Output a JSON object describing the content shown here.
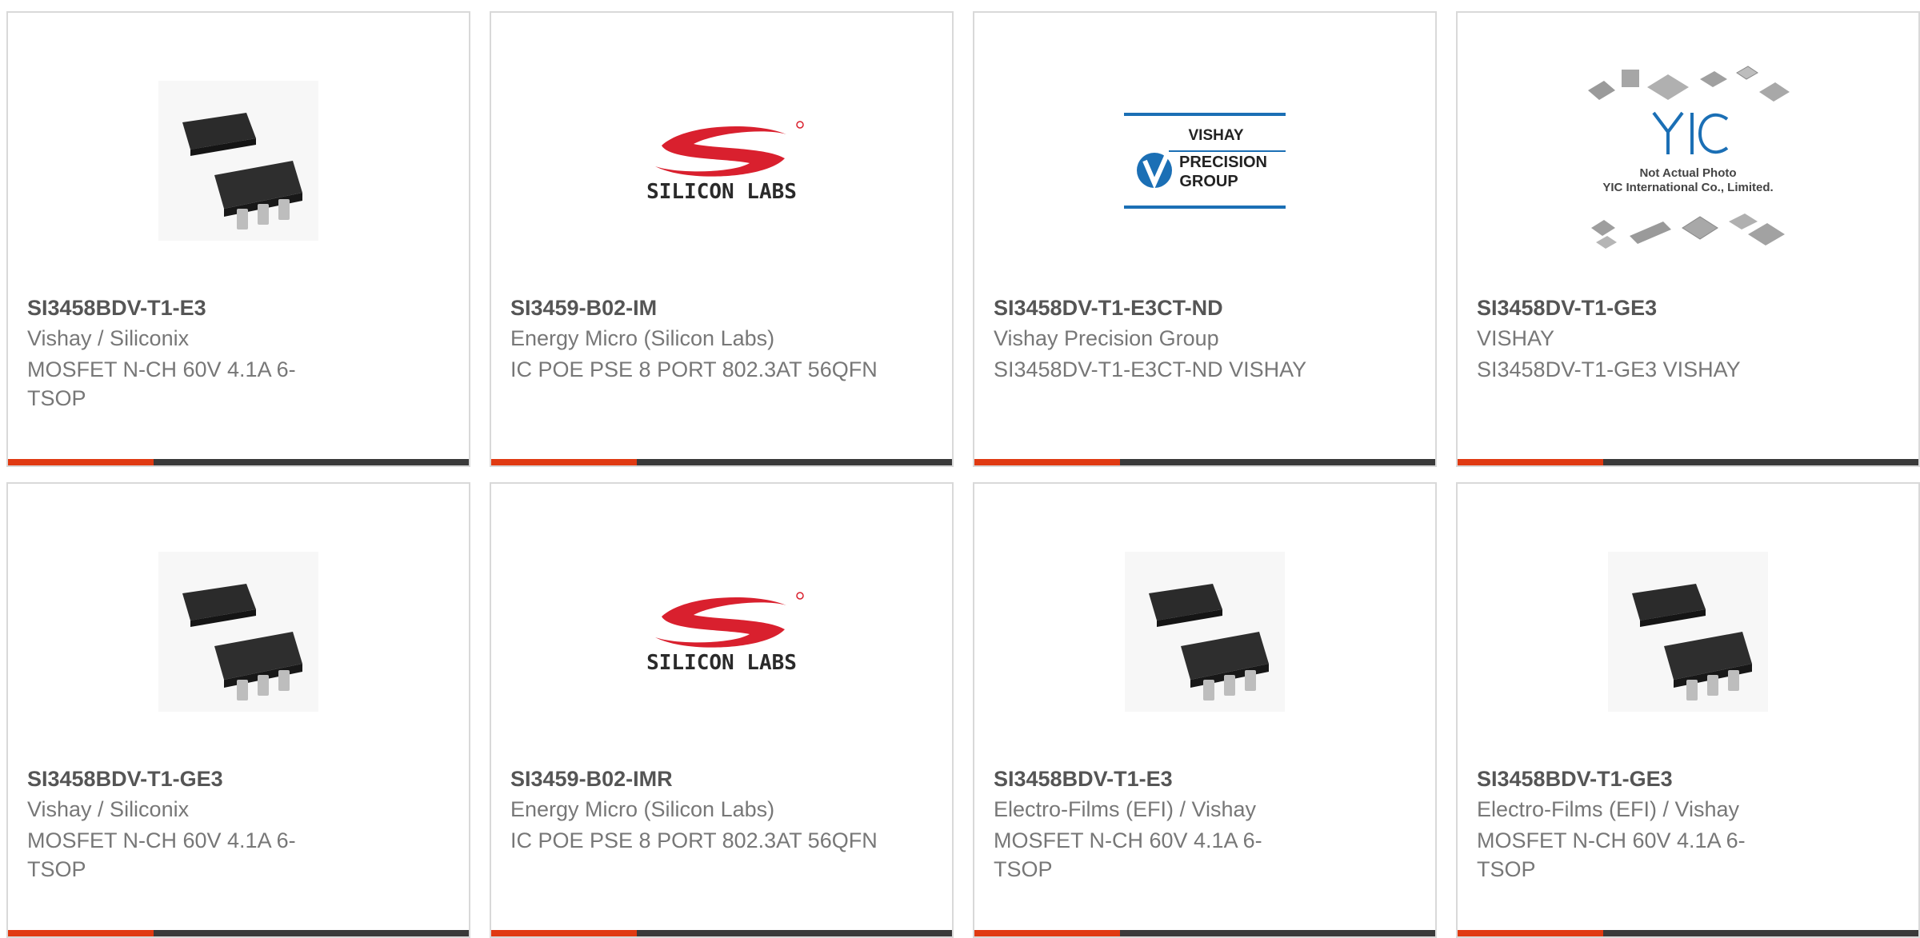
{
  "products": [
    {
      "part": "SI3458BDV-T1-E3",
      "maker": "Vishay / Siliconix",
      "desc": "MOSFET N-CH 60V 4.1A 6-TSOP",
      "image_icon": "chip-package-icon"
    },
    {
      "part": "SI3459-B02-IM",
      "maker": "Energy Micro (Silicon Labs)",
      "desc": "IC POE PSE 8 PORT 802.3AT 56QFN",
      "image_icon": "silicon-labs-logo",
      "logo_text": "SILICON LABS"
    },
    {
      "part": "SI3458DV-T1-E3CT-ND",
      "maker": "Vishay Precision Group",
      "desc": "SI3458DV-T1-E3CT-ND VISHAY",
      "image_icon": "vishay-precision-group-logo",
      "logo_lines": [
        "VISHAY",
        "PRECISION",
        "GROUP"
      ]
    },
    {
      "part": "SI3458DV-T1-GE3",
      "maker": "VISHAY",
      "desc": "SI3458DV-T1-GE3 VISHAY",
      "image_icon": "yic-placeholder-photo",
      "placeholder_lines": [
        "Not Actual Photo",
        "YIC International Co., Limited."
      ]
    },
    {
      "part": "SI3458BDV-T1-GE3",
      "maker": "Vishay / Siliconix",
      "desc": "MOSFET N-CH 60V 4.1A 6-TSOP",
      "image_icon": "chip-package-icon"
    },
    {
      "part": "SI3459-B02-IMR",
      "maker": "Energy Micro (Silicon Labs)",
      "desc": "IC POE PSE 8 PORT 802.3AT 56QFN",
      "image_icon": "silicon-labs-logo",
      "logo_text": "SILICON LABS"
    },
    {
      "part": "SI3458BDV-T1-E3",
      "maker": "Electro-Films (EFI) / Vishay",
      "desc": "MOSFET N-CH 60V 4.1A 6-TSOP",
      "image_icon": "chip-package-icon"
    },
    {
      "part": "SI3458BDV-T1-GE3",
      "maker": "Electro-Films (EFI) / Vishay",
      "desc": "MOSFET N-CH 60V 4.1A 6-TSOP",
      "image_icon": "chip-package-icon"
    }
  ],
  "colors": {
    "accent": "#e03a12",
    "bar": "#3a3a3a",
    "part_text": "#555555",
    "body_text": "#777777",
    "silicon_labs_red": "#d9202e",
    "vishay_blue": "#1b6fb5"
  }
}
